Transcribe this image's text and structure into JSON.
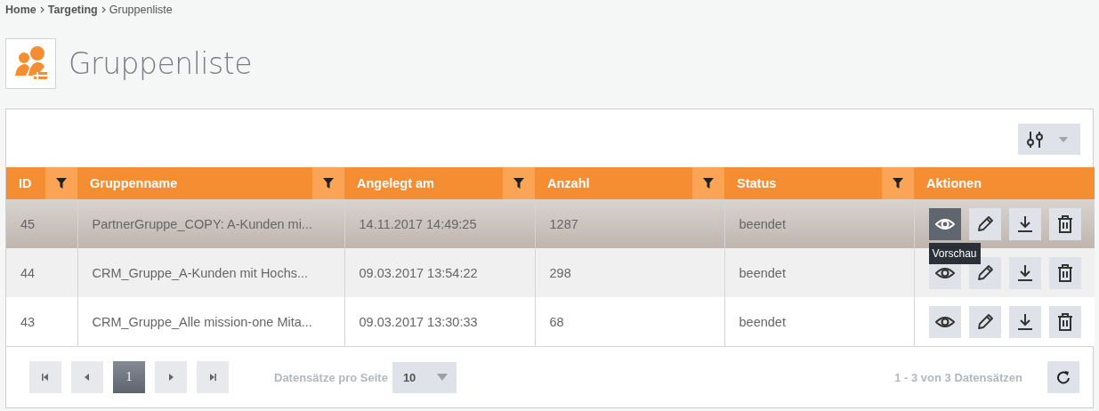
{
  "breadcrumb": [
    {
      "label": "Home",
      "link": true
    },
    {
      "label": "Targeting",
      "link": true
    },
    {
      "label": "Gruppenliste",
      "link": false
    }
  ],
  "page_title": "Gruppenliste",
  "table": {
    "columns": [
      {
        "label": "ID",
        "filter": true
      },
      {
        "label": "Gruppenname",
        "filter": true
      },
      {
        "label": "Angelegt am",
        "filter": true
      },
      {
        "label": "Anzahl",
        "filter": true
      },
      {
        "label": "Status",
        "filter": true
      },
      {
        "label": "Aktionen",
        "filter": false
      }
    ],
    "rows": [
      {
        "selected": true,
        "cells": [
          "45",
          "PartnerGruppe_COPY: A-Kunden mi...",
          "14.11.2017 14:49:25",
          "1287",
          "beendet"
        ],
        "actions": [
          {
            "kind": "view",
            "hovered": true
          },
          {
            "kind": "edit",
            "hovered": false
          },
          {
            "kind": "download",
            "hovered": false
          },
          {
            "kind": "delete",
            "hovered": false
          }
        ]
      },
      {
        "selected": false,
        "cells": [
          "44",
          "CRM_Gruppe_A-Kunden mit Hochs...",
          "09.03.2017 13:54:22",
          "298",
          "beendet"
        ],
        "actions": [
          {
            "kind": "view",
            "hovered": false
          },
          {
            "kind": "edit",
            "hovered": false
          },
          {
            "kind": "download",
            "hovered": false
          },
          {
            "kind": "delete",
            "hovered": false
          }
        ]
      },
      {
        "selected": false,
        "cells": [
          "43",
          "CRM_Gruppe_Alle mission-one Mita...",
          "09.03.2017 13:30:33",
          "68",
          "beendet"
        ],
        "actions": [
          {
            "kind": "view",
            "hovered": false
          },
          {
            "kind": "edit",
            "hovered": false
          },
          {
            "kind": "download",
            "hovered": false
          },
          {
            "kind": "delete",
            "hovered": false
          }
        ]
      }
    ]
  },
  "tooltip": "Vorschau",
  "pagination": {
    "pages": [
      {
        "label": "1",
        "selected": true
      }
    ],
    "page_size_label": "Datensätze pro Seite",
    "page_size": "10",
    "info": "1 - 3 von 3 Datensätzen"
  }
}
